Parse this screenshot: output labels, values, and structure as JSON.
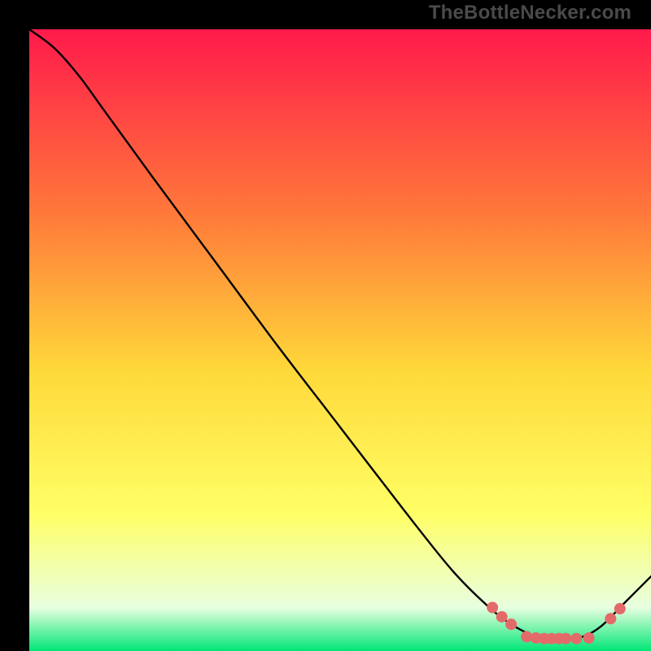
{
  "watermark": "TheBottleNecker.com",
  "chart_data": {
    "type": "line",
    "title": "",
    "xlabel": "",
    "ylabel": "",
    "xlim": [
      0,
      100
    ],
    "ylim": [
      0,
      100
    ],
    "grid": false,
    "background_gradient": {
      "top": "#ff1a4b",
      "mid_upper": "#ff7a3a",
      "mid": "#ffd93a",
      "mid_lower": "#ffff66",
      "near_bottom": "#e8ffe0",
      "bottom": "#00e676"
    },
    "curve": {
      "description": "Starts at top-left near y=100, slight convex bend near x≈7, then steep near-linear descent to a flat minimum around x≈82-89 at y≈2, then rises toward the right edge.",
      "x": [
        0,
        4,
        8,
        12,
        20,
        30,
        40,
        50,
        60,
        68,
        74,
        78,
        82,
        86,
        89,
        92,
        96,
        100
      ],
      "y": [
        100,
        97,
        92.5,
        87,
        76,
        62.5,
        49,
        36,
        23,
        13,
        7,
        4,
        2.2,
        2,
        2.3,
        4,
        8,
        12
      ]
    },
    "markers": {
      "color": "#e46a6a",
      "radius_px": 7,
      "points": [
        {
          "x": 74.5,
          "y": 7.0
        },
        {
          "x": 76.0,
          "y": 5.5
        },
        {
          "x": 77.5,
          "y": 4.3
        },
        {
          "x": 80.0,
          "y": 2.3
        },
        {
          "x": 81.5,
          "y": 2.1
        },
        {
          "x": 82.8,
          "y": 2.0
        },
        {
          "x": 84.0,
          "y": 2.0
        },
        {
          "x": 85.2,
          "y": 2.0
        },
        {
          "x": 86.3,
          "y": 2.0
        },
        {
          "x": 88.0,
          "y": 2.0
        },
        {
          "x": 90.0,
          "y": 2.1
        },
        {
          "x": 93.5,
          "y": 5.2
        },
        {
          "x": 95.0,
          "y": 6.8
        }
      ]
    }
  }
}
